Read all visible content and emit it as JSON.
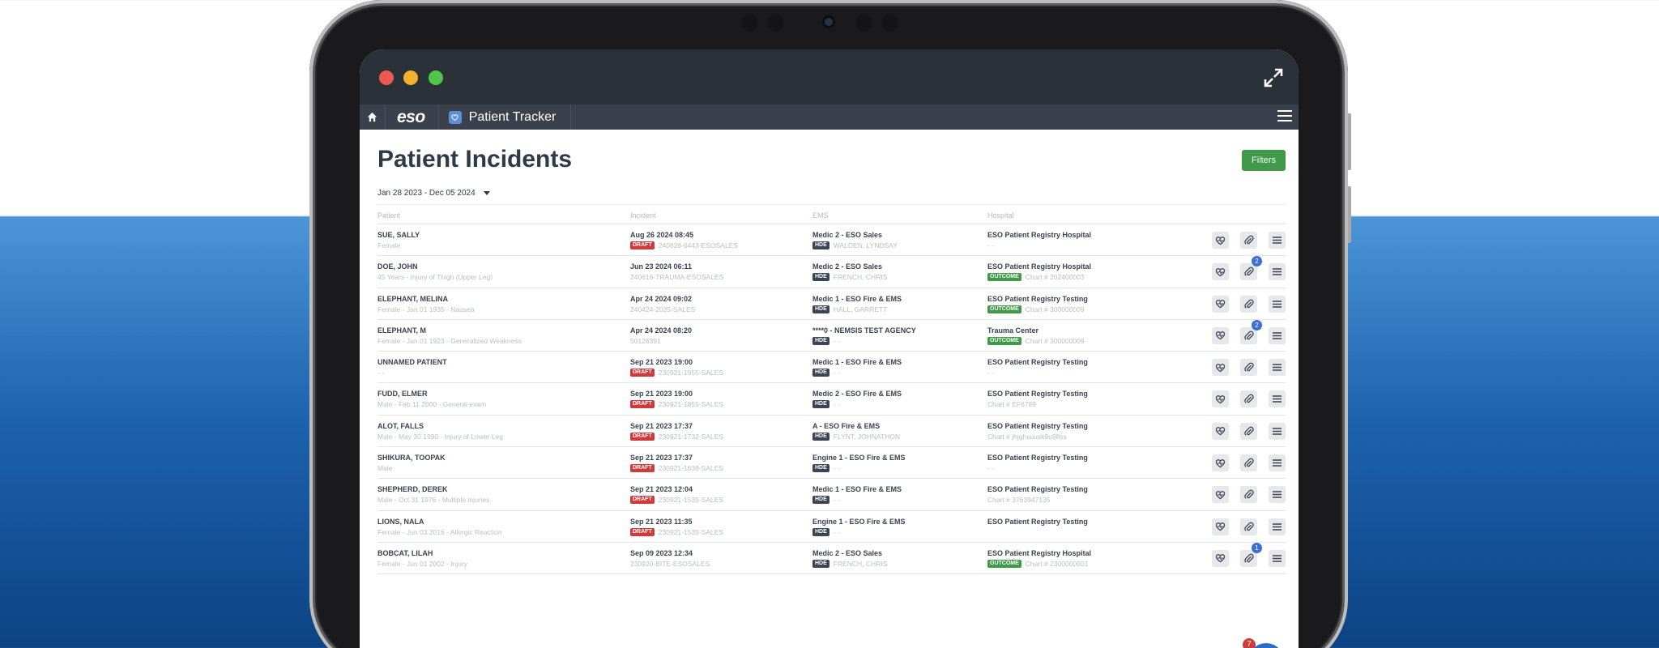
{
  "app": {
    "brand": "eso",
    "module": "Patient Tracker"
  },
  "page": {
    "title": "Patient Incidents",
    "filters_label": "Filters",
    "date_range": "Jan 28 2023 - Dec 05 2024"
  },
  "columns": [
    "Patient",
    "Incident",
    "EMS",
    "Hospital"
  ],
  "rows": [
    {
      "patient": "SUE, SALLY",
      "patient_detail": "Female",
      "incident_date": "Aug 26 2024 08:45",
      "incident_badge": "DRAFT",
      "incident_id": "240826-6443-ESOSALES",
      "ems_unit": "Medic 2 - ESO Sales",
      "ems_badge": "HDE",
      "ems_crew": "WALDEN, LYNDSAY",
      "hospital": "ESO Patient Registry Hospital",
      "hospital_badge": "",
      "hospital_detail": "- -",
      "attachments": ""
    },
    {
      "patient": "DOE, JOHN",
      "patient_detail": "45 Years - Injury of Thigh (Upper Leg)",
      "incident_date": "Jun 23 2024 06:11",
      "incident_badge": "",
      "incident_id": "240616-TRAUMA-ESOSALES",
      "ems_unit": "Medic 2 - ESO Sales",
      "ems_badge": "HDE",
      "ems_crew": "FRENCH, CHRIS",
      "hospital": "ESO Patient Registry Hospital",
      "hospital_badge": "OUTCOME",
      "hospital_detail": "Chart # 202400003",
      "attachments": "2"
    },
    {
      "patient": "ELEPHANT, MELINA",
      "patient_detail": "Female - Jan 01 1935 - Nausea",
      "incident_date": "Apr 24 2024 09:02",
      "incident_badge": "",
      "incident_id": "240424-2025-SALES",
      "ems_unit": "Medic 1 - ESO Fire & EMS",
      "ems_badge": "HDE",
      "ems_crew": "HALL, GARRETT",
      "hospital": "ESO Patient Registry Testing",
      "hospital_badge": "OUTCOME",
      "hospital_detail": "Chart # 300000009",
      "attachments": ""
    },
    {
      "patient": "ELEPHANT, M",
      "patient_detail": "Female - Jan 01 1923 - Generalized Weakness",
      "incident_date": "Apr 24 2024 08:20",
      "incident_badge": "",
      "incident_id": "50126391",
      "ems_unit": "****0 - NEMSIS TEST AGENCY",
      "ems_badge": "HDE",
      "ems_crew": "- -",
      "hospital": "Trauma Center",
      "hospital_badge": "OUTCOME",
      "hospital_detail": "Chart # 300000009",
      "attachments": "2"
    },
    {
      "patient": "UNNAMED PATIENT",
      "patient_detail": "- -",
      "incident_date": "Sep 21 2023 19:00",
      "incident_badge": "DRAFT",
      "incident_id": "230921-1955-SALES",
      "ems_unit": "Medic 1 - ESO Fire & EMS",
      "ems_badge": "HDE",
      "ems_crew": "- -",
      "hospital": "ESO Patient Registry Testing",
      "hospital_badge": "",
      "hospital_detail": "- -",
      "attachments": ""
    },
    {
      "patient": "FUDD, ELMER",
      "patient_detail": "Male - Feb 11 2000 - General exam",
      "incident_date": "Sep 21 2023 19:00",
      "incident_badge": "DRAFT",
      "incident_id": "230921-1855-SALES",
      "ems_unit": "Medic 2 - ESO Fire & EMS",
      "ems_badge": "HDE",
      "ems_crew": "- -",
      "hospital": "ESO Patient Registry Testing",
      "hospital_badge": "",
      "hospital_detail": "Chart # EF6789",
      "attachments": ""
    },
    {
      "patient": "ALOT, FALLS",
      "patient_detail": "Male - May 30 1990 - Injury of Lower Leg",
      "incident_date": "Sep 21 2023 17:37",
      "incident_badge": "DRAFT",
      "incident_id": "230921-1732-SALES",
      "ems_unit": "A - ESO Fire & EMS",
      "ems_badge": "HDE",
      "ems_crew": "FLYNT, JOHNATHON",
      "hospital": "ESO Patient Registry Testing",
      "hospital_badge": "",
      "hospital_detail": "Chart # jhjghsuusk9u98ss",
      "attachments": ""
    },
    {
      "patient": "SHIKURA, TOOPAK",
      "patient_detail": "Male",
      "incident_date": "Sep 21 2023 17:37",
      "incident_badge": "DRAFT",
      "incident_id": "230921-1638-SALES",
      "ems_unit": "Engine 1 - ESO Fire & EMS",
      "ems_badge": "HDE",
      "ems_crew": "- -",
      "hospital": "ESO Patient Registry Testing",
      "hospital_badge": "",
      "hospital_detail": "- -",
      "attachments": ""
    },
    {
      "patient": "SHEPHERD, DEREK",
      "patient_detail": "Male - Oct 31 1976 - Multiple injuries",
      "incident_date": "Sep 21 2023 12:04",
      "incident_badge": "DRAFT",
      "incident_id": "230921-1535-SALES",
      "ems_unit": "Medic 1 - ESO Fire & EMS",
      "ems_badge": "HDE",
      "ems_crew": "- -",
      "hospital": "ESO Patient Registry Testing",
      "hospital_badge": "",
      "hospital_detail": "Chart # 3763947135",
      "attachments": ""
    },
    {
      "patient": "LIONS, NALA",
      "patient_detail": "Female - Jun 03 2016 - Allergic Reaction",
      "incident_date": "Sep 21 2023 11:35",
      "incident_badge": "DRAFT",
      "incident_id": "230921-1535-SALES",
      "ems_unit": "Engine 1 - ESO Fire & EMS",
      "ems_badge": "HDE",
      "ems_crew": "- -",
      "hospital": "ESO Patient Registry Testing",
      "hospital_badge": "",
      "hospital_detail": "",
      "attachments": ""
    },
    {
      "patient": "BOBCAT, LILAH",
      "patient_detail": "Female - Jun 01 2002 - Injury",
      "incident_date": "Sep 09 2023 12:34",
      "incident_badge": "",
      "incident_id": "230920-BITE-ESOSALES",
      "ems_unit": "Medic 2 - ESO Sales",
      "ems_badge": "HDE",
      "ems_crew": "FRENCH, CHRIS",
      "hospital": "ESO Patient Registry Hospital",
      "hospital_badge": "OUTCOME",
      "hospital_detail": "Chart # 2300000001",
      "attachments": "1"
    }
  ],
  "help": {
    "icon": "?",
    "count": "7"
  },
  "colors": {
    "brand_green": "#3f9a4a",
    "draft_red": "#cf3b3b",
    "appbar": "#3a414c",
    "titlebar": "#2b3138"
  }
}
